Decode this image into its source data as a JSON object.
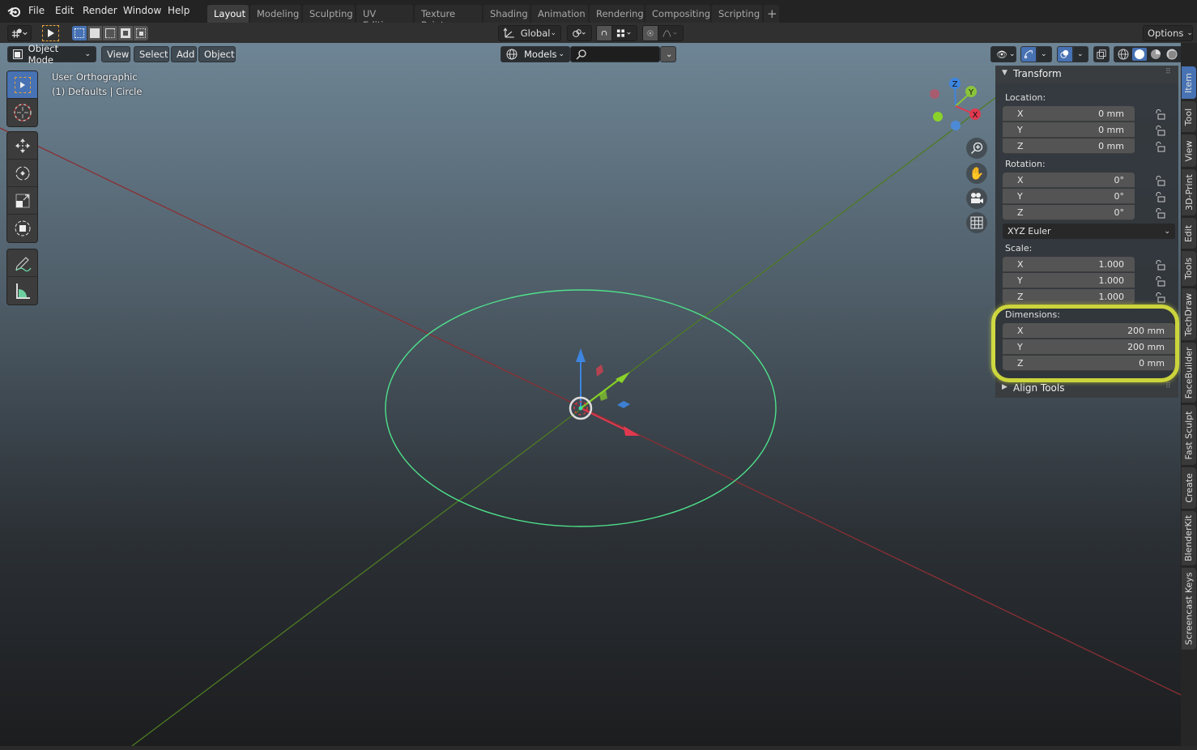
{
  "topbar": {
    "menus": [
      "File",
      "Edit",
      "Render",
      "Window",
      "Help"
    ],
    "workspaces": [
      {
        "label": "Layout",
        "active": true
      },
      {
        "label": "Modeling",
        "active": false
      },
      {
        "label": "Sculpting",
        "active": false
      },
      {
        "label": "UV Editing",
        "active": false
      },
      {
        "label": "Texture Paint",
        "active": false
      },
      {
        "label": "Shading",
        "active": false
      },
      {
        "label": "Animation",
        "active": false
      },
      {
        "label": "Rendering",
        "active": false
      },
      {
        "label": "Compositing",
        "active": false
      },
      {
        "label": "Scripting",
        "active": false
      }
    ],
    "add_workspace": "+"
  },
  "toolheader": {
    "transform_orientation": "Global",
    "options_label": "Options"
  },
  "viewport_header": {
    "mode": "Object Mode",
    "menus": [
      "View",
      "Select",
      "Add",
      "Object"
    ],
    "collection_filter": "Models",
    "search_value": ""
  },
  "viewport": {
    "view_name": "User Orthographic",
    "object_info": "(1) Defaults | Circle",
    "gizmo_axes": [
      "X",
      "Y",
      "Z"
    ],
    "colors": {
      "x_axis": "#a33a3a",
      "y_axis": "#5c8a26",
      "circle": "#4ee08a",
      "accent": "#4772b3",
      "highlight": "#e6f03c"
    }
  },
  "npanel": {
    "transform_title": "Transform",
    "location": {
      "label": "Location:",
      "x": "0 mm",
      "y": "0 mm",
      "z": "0 mm"
    },
    "rotation": {
      "label": "Rotation:",
      "x": "0°",
      "y": "0°",
      "z": "0°"
    },
    "rotation_mode": "XYZ Euler",
    "scale": {
      "label": "Scale:",
      "x": "1.000",
      "y": "1.000",
      "z": "1.000"
    },
    "dimensions": {
      "label": "Dimensions:",
      "x": "200 mm",
      "y": "200 mm",
      "z": "0 mm"
    },
    "axis_labels": [
      "X",
      "Y",
      "Z"
    ],
    "align_tools": "Align Tools"
  },
  "sidetabs": [
    {
      "label": "Item",
      "active": true
    },
    {
      "label": "Tool",
      "active": false
    },
    {
      "label": "View",
      "active": false
    },
    {
      "label": "3D-Print",
      "active": false
    },
    {
      "label": "Edit",
      "active": false
    },
    {
      "label": "Tools",
      "active": false
    },
    {
      "label": "TechDraw",
      "active": false
    },
    {
      "label": "FaceBuilder",
      "active": false
    },
    {
      "label": "Fast Sculpt",
      "active": false
    },
    {
      "label": "Create",
      "active": false
    },
    {
      "label": "BlenderKit",
      "active": false
    },
    {
      "label": "Screencast Keys",
      "active": false
    }
  ]
}
